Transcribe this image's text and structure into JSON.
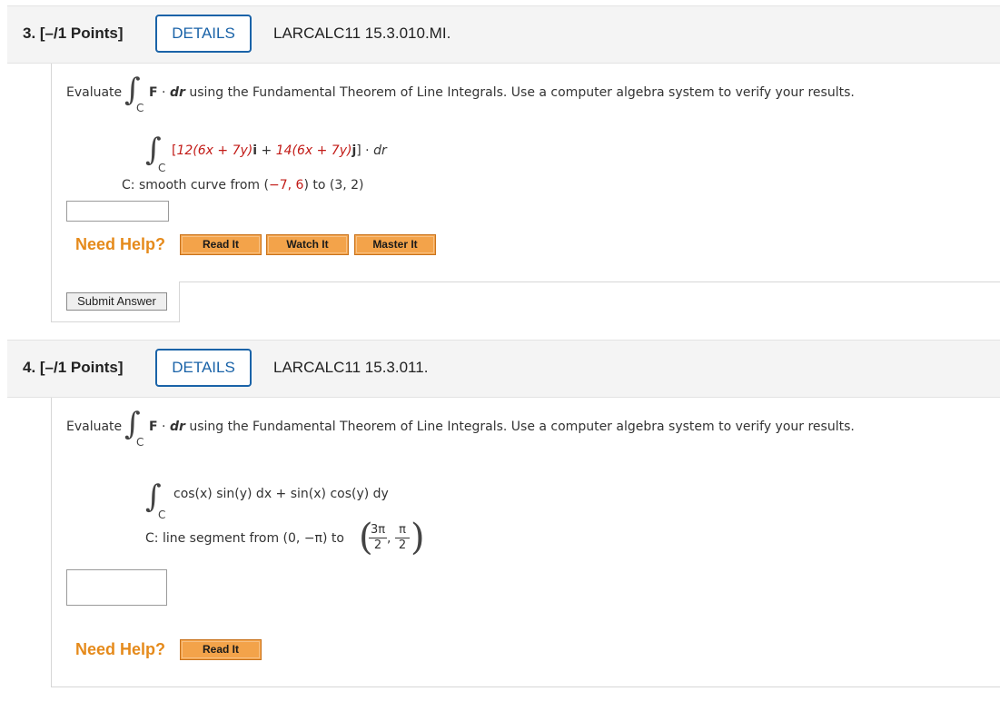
{
  "q3": {
    "number": "3. [–/1 Points]",
    "details": "DETAILS",
    "code": "LARCALC11 15.3.010.MI.",
    "evaluate": "Evaluate",
    "int_sub": "C",
    "F": "F",
    "dot": " · ",
    "dr": "dr",
    "instruction": " using the Fundamental Theorem of Line Integrals. Use a computer algebra system to verify your results.",
    "integrand": {
      "p1": "[",
      "p2": "12(6x + 7y)",
      "p3": "i",
      "p4": " + ",
      "p5": "14(6x + 7y)",
      "p6": "j",
      "p7": "] · ",
      "p8": "dr"
    },
    "curve": {
      "p1": "C: smooth curve from (",
      "p2": "−7, 6",
      "p3": ") to (3, 2)"
    },
    "need_help": "Need Help?",
    "buttons": [
      "Read It",
      "Watch It",
      "Master It"
    ],
    "submit": "Submit Answer"
  },
  "q4": {
    "number": "4. [–/1 Points]",
    "details": "DETAILS",
    "code": "LARCALC11 15.3.011.",
    "evaluate": "Evaluate",
    "int_sub": "C",
    "F": "F",
    "dot": " · ",
    "dr": "dr",
    "instruction": " using the Fundamental Theorem of Line Integrals. Use a computer algebra system to verify your results.",
    "integrand": "cos(x) sin(y) dx + sin(x) cos(y) dy",
    "segment": "C: line segment from (0, −π) to",
    "end_point": {
      "num1": "3π",
      "den1": "2",
      "comma": ",",
      "num2": "π",
      "den2": "2"
    },
    "need_help": "Need Help?",
    "buttons": [
      "Read It"
    ]
  }
}
